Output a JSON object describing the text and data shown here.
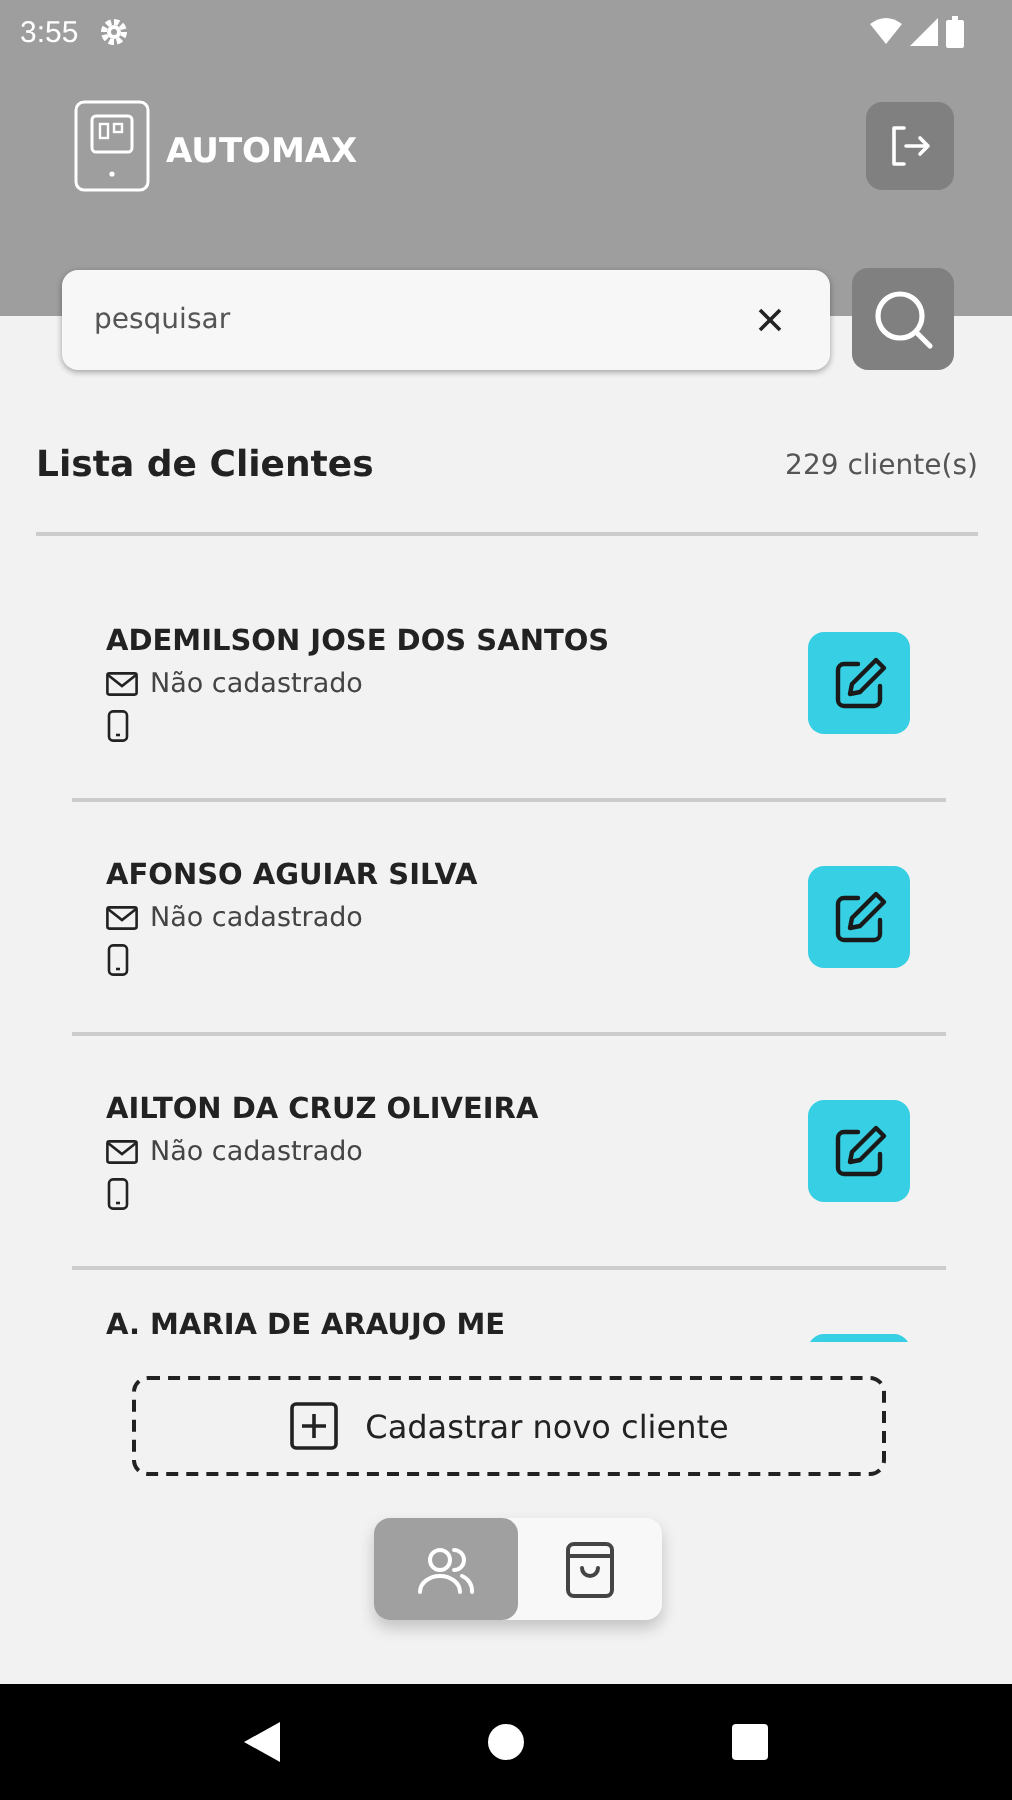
{
  "status_bar": {
    "time": "3:55"
  },
  "header": {
    "title": "AUTOMAX"
  },
  "search": {
    "placeholder": "pesquisar"
  },
  "list": {
    "title": "Lista de Clientes",
    "count": "229 cliente(s)"
  },
  "clients": [
    {
      "name": "ADEMILSON JOSE DOS SANTOS",
      "email": "Não cadastrado"
    },
    {
      "name": "AFONSO AGUIAR SILVA",
      "email": "Não cadastrado"
    },
    {
      "name": "AILTON DA CRUZ OLIVEIRA",
      "email": "Não cadastrado"
    },
    {
      "name": "A. MARIA DE ARAUJO ME"
    }
  ],
  "add_button": {
    "label": "Cadastrar novo cliente"
  },
  "nav_tabs": [
    {
      "kind": "clients",
      "selected": true
    },
    {
      "kind": "orders",
      "selected": false
    }
  ]
}
